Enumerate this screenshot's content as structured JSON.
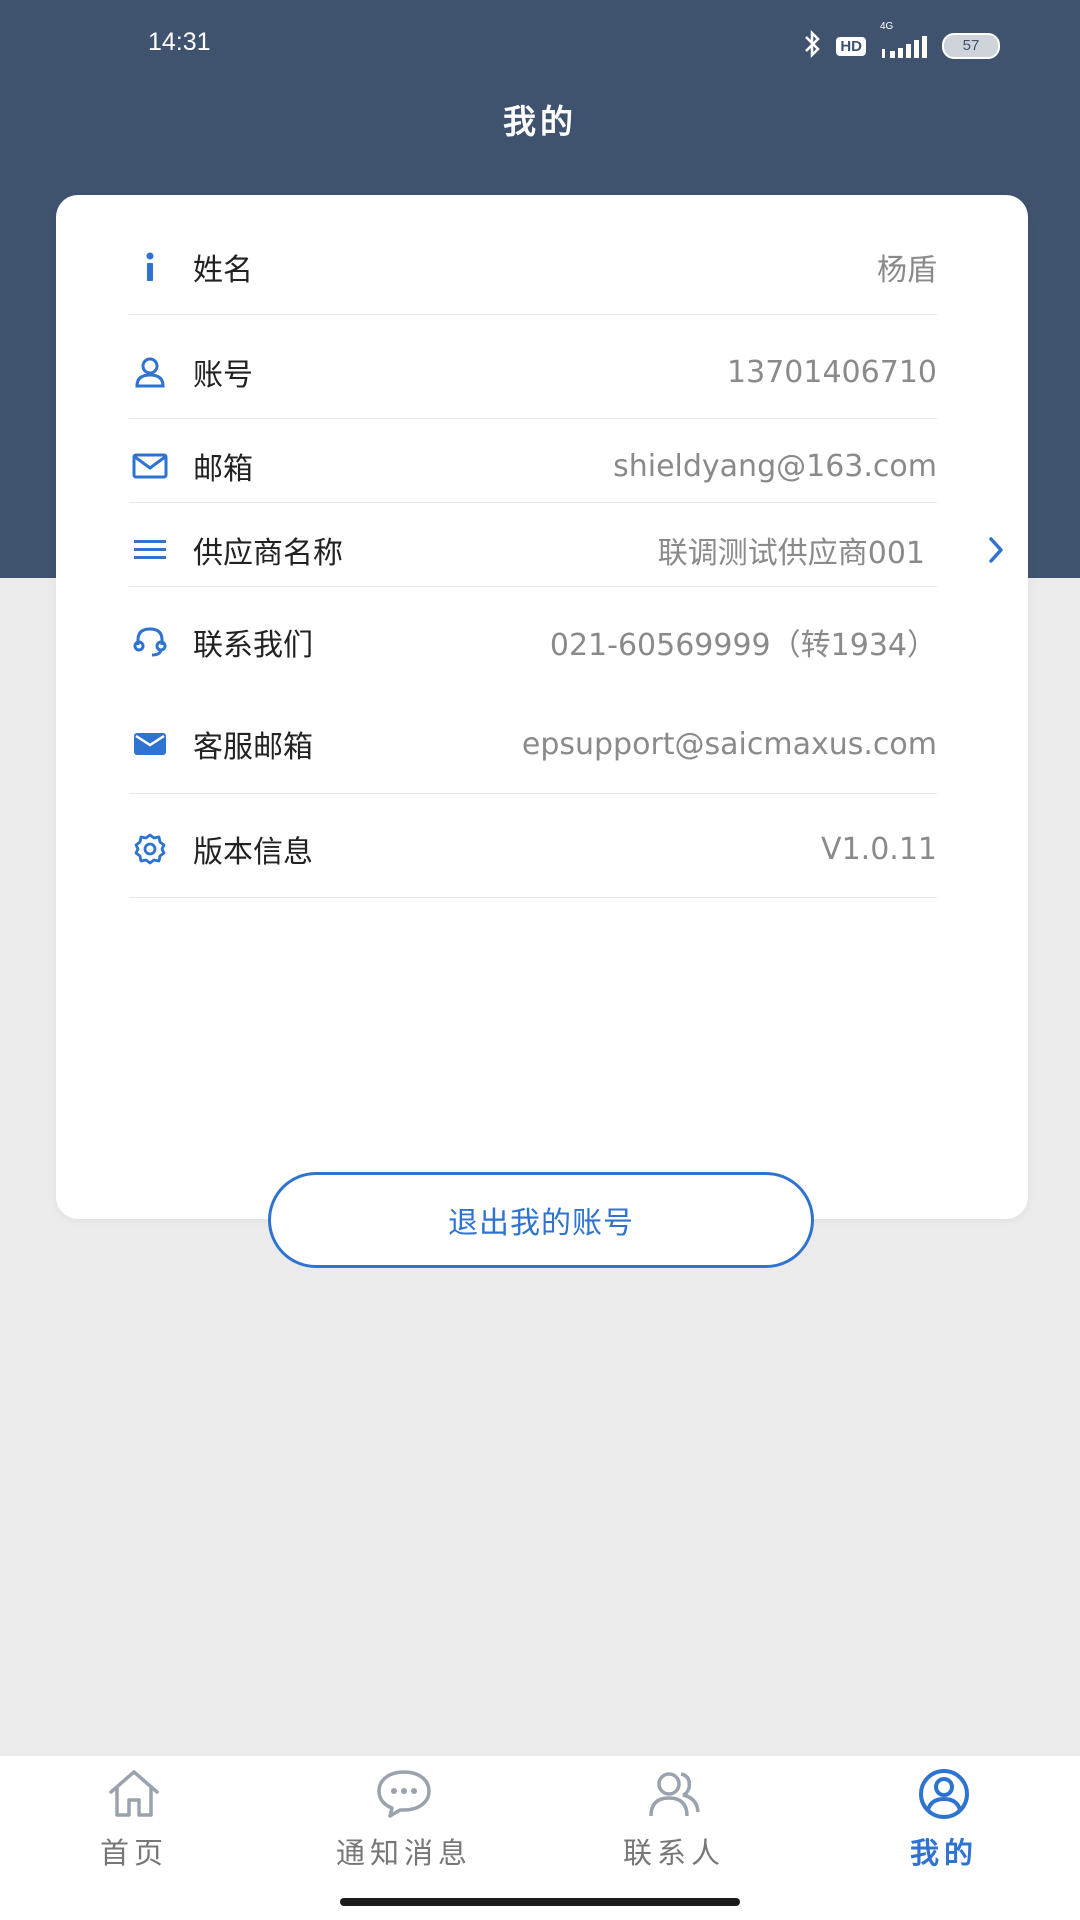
{
  "status_bar": {
    "time": "14:31",
    "hd": "HD",
    "network": "4G",
    "battery": "57"
  },
  "header": {
    "title": "我的"
  },
  "profile_rows": [
    {
      "icon": "info-icon",
      "label": "姓名",
      "value": "杨盾"
    },
    {
      "icon": "user-icon",
      "label": "账号",
      "value": "13701406710"
    },
    {
      "icon": "mail-icon",
      "label": "邮箱",
      "value": "shieldyang@163.com"
    },
    {
      "icon": "menu-lines-icon",
      "label": "供应商名称",
      "value": "联调测试供应商001"
    },
    {
      "icon": "headset-icon",
      "label": "联系我们",
      "value": "021-60569999（转1934）"
    },
    {
      "icon": "mail-filled-icon",
      "label": "客服邮箱",
      "value": "epsupport@saicmaxus.com"
    },
    {
      "icon": "settings-icon",
      "label": "版本信息",
      "value": "V1.0.11"
    }
  ],
  "logout_label": "退出我的账号",
  "tabbar": {
    "tabs": [
      {
        "label": "首页",
        "icon": "home-icon",
        "active": false
      },
      {
        "label": "通知消息",
        "icon": "chat-bubble-icon",
        "active": false
      },
      {
        "label": "联系人",
        "icon": "contacts-icon",
        "active": false
      },
      {
        "label": "我的",
        "icon": "profile-circle-icon",
        "active": true
      }
    ]
  },
  "colors": {
    "header_bg": "#3f526e",
    "accent": "#2f73d0",
    "page_bg": "#ebebeb",
    "value_text": "#8a8a8a"
  }
}
